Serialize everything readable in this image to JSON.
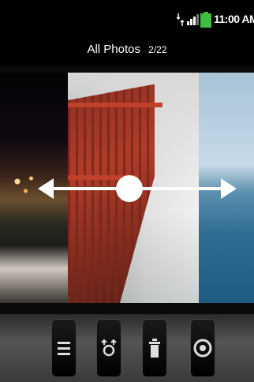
{
  "status_bar": {
    "time": "11:00 AM",
    "icons": [
      "sync-icon",
      "signal-icon",
      "battery-icon"
    ]
  },
  "header": {
    "title": "All Photos",
    "count": "2/22"
  },
  "gallery": {
    "photos": [
      "city-night-photo",
      "golden-gate-railing-photo",
      "ocean-photo"
    ]
  },
  "gesture": {
    "type": "swipe-horizontal",
    "color": "#ffffff"
  },
  "toolbar": {
    "buttons": [
      "menu-icon",
      "share-icon",
      "delete-icon",
      "camera-icon"
    ]
  },
  "colors": {
    "background": "#000000",
    "railing": "#b33b27",
    "toolbar": "#555555"
  }
}
